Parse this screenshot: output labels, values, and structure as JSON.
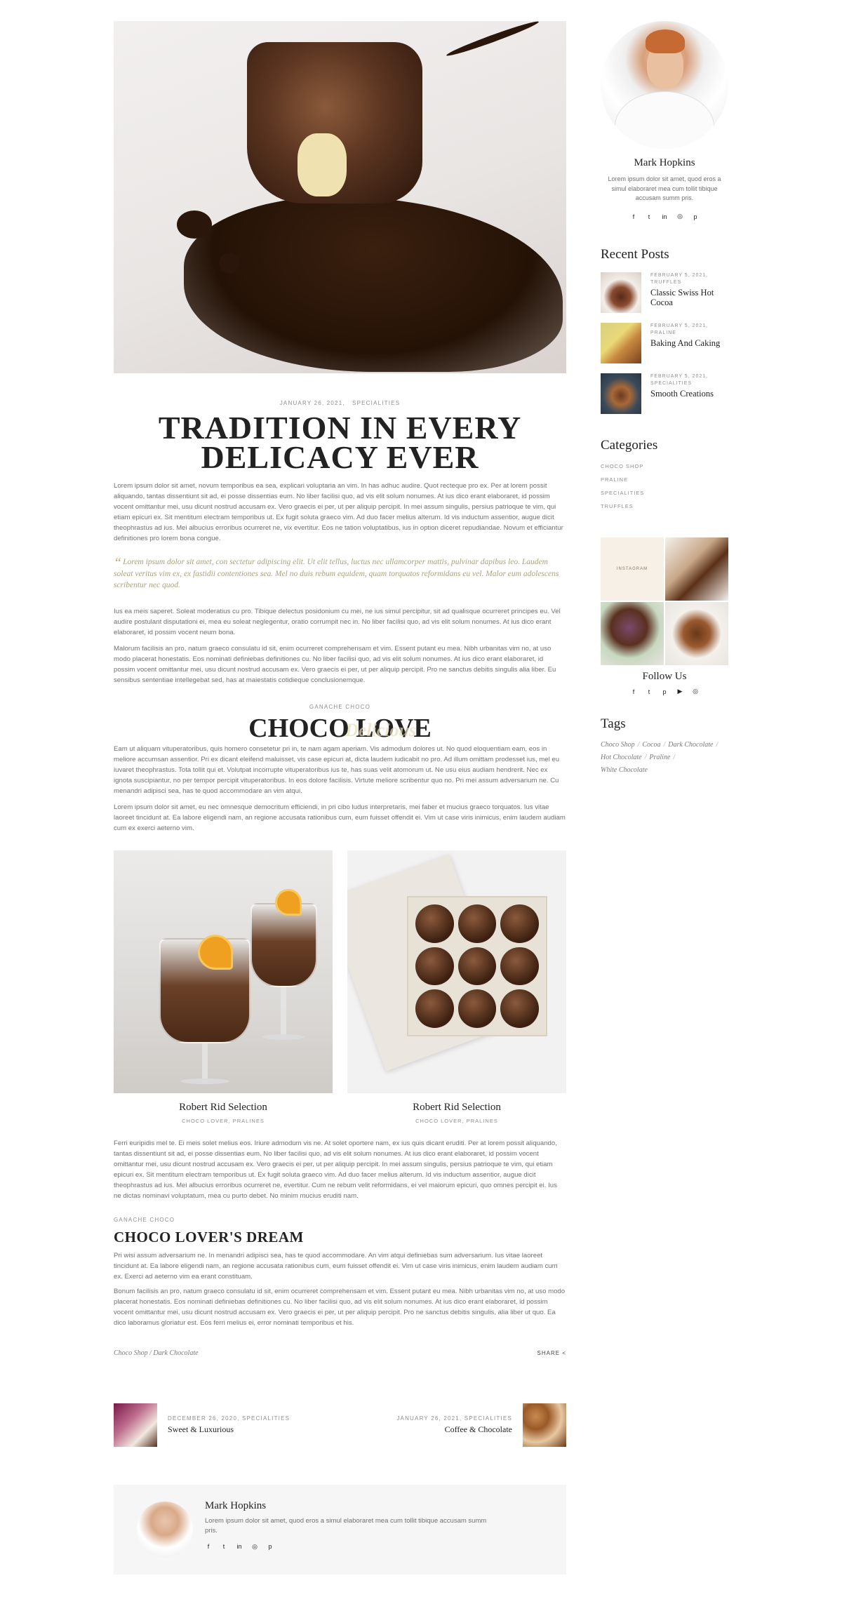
{
  "post": {
    "date": "JANUARY 26, 2021,",
    "category": "SPECIALITIES",
    "title_line1": "Tradition in every",
    "title_line2": "delicacy ever",
    "para1": "Lorem ipsum dolor sit amet, novum temporibus ea sea, explicari voluptaria an vim. In has adhuc audire. Quot recteque pro ex. Per at lorem possit aliquando, tantas dissentiunt sit ad, ei posse dissentias eum. No liber facilisi quo, ad vis elit solum nonumes. At ius dico erant elaboraret, id possim vocent omittantur mei, usu dicunt nostrud accusam ex. Vero graecis ei per, ut per aliquip percipit. In mei assum singulis, persius patrioque te vim, qui etiam epicuri ex. Sit mentitum electram temporibus ut. Ex fugit soluta graeco vim. Ad duo facer melius alterum. Id vis inductum assentior, augue dicit theophrastus ad ius. Mei albucius erroribus ocurreret ne, vix evertitur. Eos ne tation voluptatibus, ius in option diceret repudiandae. Novum et efficiantur definitiones pro lorem bona congue.",
    "quote": "Lorem ipsum dolor sit amet, con sectetur adipiscing elit. Ut elit tellus, luctus nec ullamcorper mattis, pulvinar dapibus leo. Laudem soleat veritus vim ex, ex fastidii contentiones sea. Mel no duis rebum equidem, quam torquatos reformidans eu vel. Malor eum adolescens scribentur nec quod.",
    "para2": "Ius ea meis saperet. Soleat moderatius cu pro. Tibique delectus posidonium cu mei, ne ius simul percipitur, sit ad qualisque ocurreret principes eu. Vel audire postulant disputationi ei, mea eu soleat neglegentur, oratio corrumpit nec in. No liber facilisi quo, ad vis elit solum nonumes. At ius dico erant elaboraret, id possim vocent neum bona.",
    "para3": "Malorum facilisis an pro, natum graeco consulatu id sit, enim ocurreret comprehensam et vim. Essent putant eu mea. Nibh urbanitas vim no, at uso modo placerat honestatis. Eos nominati definiebas definitiones cu. No liber facilisi quo, ad vis elit solum nonumes. At ius dico erant elaboraret, id possim vocent omittantur mei, usu dicunt nostrud accusam ex. Vero graecis ei per, ut per aliquip percipit. Pro ne sanctus debitis singulis alia liber. Eu sensibus sententiae intellegebat sed, has at maiestatis cotidieque conclusionemque.",
    "section1_tag": "GANACHE CHOCO",
    "section1_title": "Choco love",
    "section1_script": "Delicious",
    "para4": "Eam ut aliquam vituperatoribus, quis homero consetetur pri in, te nam agam aperiam. Vis admodum dolores ut. No quod eloquentiam eam, eos in meliore accumsan assentior. Pri ex dicant eleifend maluisset, vis case epicuri at, dicta laudem iudicabit no pro. Ad illum omittam prodesset ius, mel eu iuvaret theophrastus. Tota tollit qui et. Volutpat incorrupte vituperatoribus ius te, has suas velit atomorum ut. Ne usu eius audiam hendrerit. Nec ex ignota suscipiantur, no per tempor percipit vituperatoribus. In eos dolore facilisis. Virtute meliore scribentur quo no. Pri mei assum adversarium ne. Cu menandri adipisci sea, has te quod accommodare an vim atqui.",
    "para5": "Lorem ipsum dolor sit amet, eu nec omnesque democritum efficiendi, in pri cibo ludus interpretaris, mei faber et mucius graeco torquatos. Ius vitae laoreet tincidunt at. Ea labore eligendi nam, an regione accusata rationibus cum, eum fuisset offendit ei. Vim ut case viris inimicus, enim laudem audiam cum ex exerci aeterno vim.",
    "gallery": [
      {
        "name": "Robert Rid Selection",
        "cats": "CHOCO LOVER, PRALINES"
      },
      {
        "name": "Robert Rid Selection",
        "cats": "CHOCO LOVER, PRALINES"
      }
    ],
    "para6": "Ferri euripidis mel te. Ei meis solet melius eos. Iriure admodum vis ne. At solet oportere nam, ex ius quis dicant eruditi. Per at lorem possit aliquando, tantas dissentiunt sit ad, ei posse dissentias eum. No liber facilisi quo, ad vis elit solum nonumes. At ius dico erant elaboraret, id possim vocent omittantur mei, usu dicunt nostrud accusam ex. Vero graecis ei per, ut per aliquip percipit. In mei assum singulis, persius patrioque te vim, qui etiam epicuri ex. Sit mentitum electram temporibus ut. Ex fugit soluta graeco vim. Ad duo facer melius alterum. Id vis inductum assentior, augue dicit theophrastus ad ius. Mei albucius erroribus ocurreret ne, evertitur. Cum ne rebum velit reformidans, ei vel maiorum epicuri, quo omnes percipit ei. Ius ne dictas nominavi voluptatum, mea cu purto debet. No minim mucius eruditi nam.",
    "section2_tag": "GANACHE CHOCO",
    "section2_title": "Choco lover's dream",
    "para7": "Pri wisi assum adversarium ne. In menandri adipisci sea, has te quod accommodare. An vim atqui definiebas sum adversarium. Ius vitae laoreet tincidunt at. Ea labore eligendi nam, an regione accusata rationibus cum, eum fuisset offendit ei. Vim ut case viris inimicus, enim laudem audiam cum ex. Exerci ad aeterno vim ea erant constituam.",
    "para8": "Bonum facilisis an pro, natum graeco consulatu id sit, enim ocurreret comprehensam et vim. Essent putant eu mea. Nibh urbanitas vim no, at uso modo placerat honestatis. Eos nominati definiebas definitiones cu. No liber facilisi quo, ad vis elit solum nonumes. At ius dico erant elaboraret, id possim vocent omittantur mei, usu dicunt nostrud accusam ex. Vero graecis ei per, ut per aliquip percipit. Pro ne sanctus debitis singulis, alia liber ut quo. Ea dico laboramus gloriatur est. Eos ferri melius ei, error nominati temporibus et his.",
    "foot_tag1": "Choco Shop",
    "foot_tag2": "Dark Chocolate",
    "tag_sep": "/",
    "share_label": "SHARE"
  },
  "navigation": {
    "prev": {
      "meta": "DECEMBER 26, 2020, SPECIALITIES",
      "title": "Sweet & Luxurious"
    },
    "next": {
      "meta": "JANUARY 26, 2021, SPECIALITIES",
      "title": "Coffee & Chocolate"
    }
  },
  "author": {
    "name": "Mark Hopkins",
    "bio": "Lorem ipsum dolor sit amet, quod eros a simul elaboraret mea cum tollit tibique accusam summ pris."
  },
  "sidebar": {
    "profile_name": "Mark Hopkins",
    "profile_bio": "Lorem ipsum dolor sit amet, quod eros a simul elaboraret mea cum tollit tibique accusam summ pris.",
    "recent_title": "Recent Posts",
    "recent": [
      {
        "date": "FEBRUARY 5, 2021,",
        "cat": "TRUFFLES",
        "title": "Classic Swiss Hot Cocoa"
      },
      {
        "date": "FEBRUARY 5, 2021,",
        "cat": "PRALINE",
        "title": "Baking And Caking"
      },
      {
        "date": "FEBRUARY 5, 2021,",
        "cat": "SPECIALITIES",
        "title": "Smooth Creations"
      }
    ],
    "categories_title": "Categories",
    "categories": [
      "CHOCO SHOP",
      "PRALINE",
      "SPECIALITIES",
      "TRUFFLES"
    ],
    "instagram_label": "INSTAGRAM",
    "follow_title": "Follow Us",
    "tags_title": "Tags",
    "tags": [
      "Choco Shop",
      "Cocoa",
      "Dark Chocolate",
      "Hot Chocolate",
      "Praline",
      "White Chocolate"
    ]
  },
  "icons": {
    "facebook": "f",
    "twitter": "t",
    "linkedin": "in",
    "instagram": "◎",
    "pinterest": "p",
    "youtube": "▶",
    "share": "<",
    "quote": "“"
  },
  "colors": {
    "accent": "#c4b176",
    "heading": "#222222",
    "text": "#707070",
    "muted": "#8e8e8e"
  }
}
